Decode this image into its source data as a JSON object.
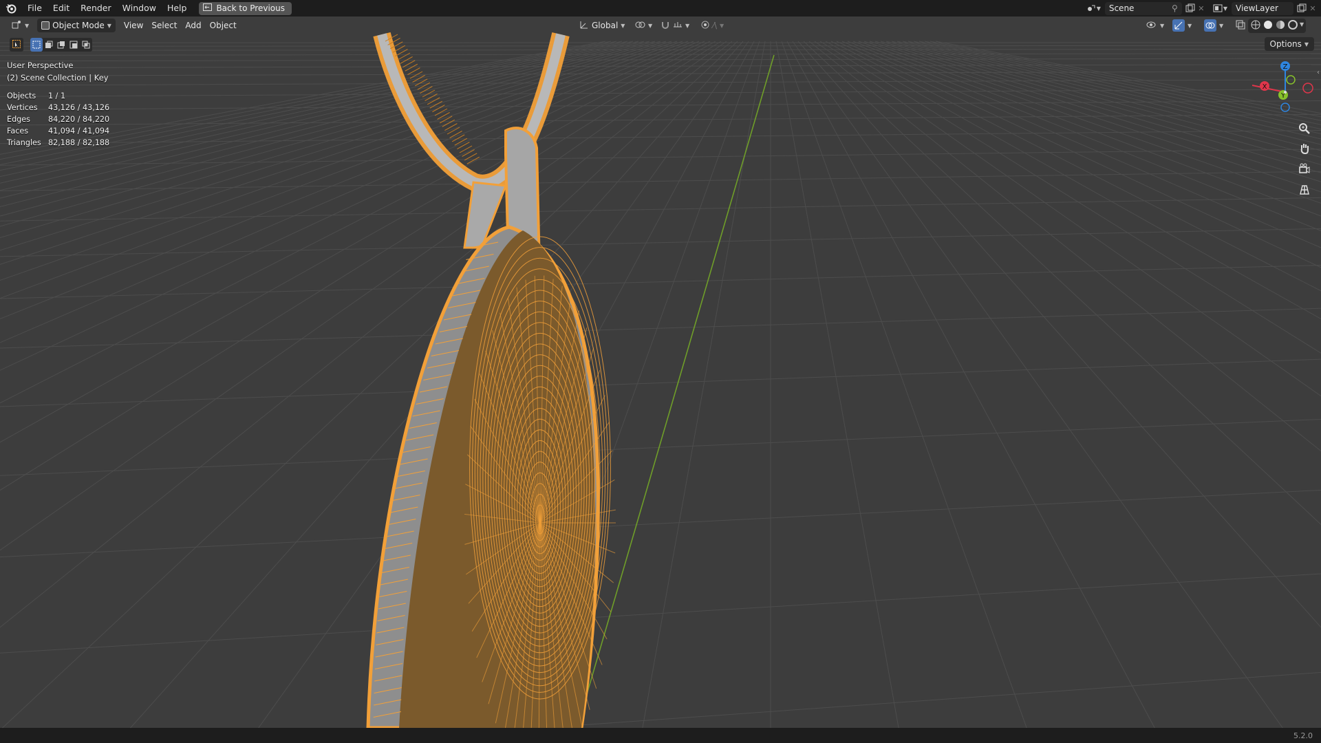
{
  "menu": {
    "items": [
      "File",
      "Edit",
      "Render",
      "Window",
      "Help"
    ],
    "back_button": "Back to Previous"
  },
  "workspace": {
    "scene_name": "Scene",
    "view_layer": "ViewLayer"
  },
  "header": {
    "mode": "Object Mode",
    "menus": [
      "View",
      "Select",
      "Add",
      "Object"
    ],
    "transform_orientation": "Global",
    "options_label": "Options"
  },
  "viewport": {
    "perspective": "User Perspective",
    "collection": "(2) Scene Collection | Key"
  },
  "stats": [
    {
      "label": "Objects",
      "value": "1 / 1"
    },
    {
      "label": "Vertices",
      "value": "43,126 / 43,126"
    },
    {
      "label": "Edges",
      "value": "84,220 / 84,220"
    },
    {
      "label": "Faces",
      "value": "41,094 / 41,094"
    },
    {
      "label": "Triangles",
      "value": "82,188 / 82,188"
    }
  ],
  "gizmo": {
    "x": "X",
    "y": "Y",
    "z": "Z"
  },
  "colors": {
    "selection": "#f2a039",
    "axis_x": "#e0364b",
    "axis_y": "#87c22b",
    "axis_z": "#2f86e0",
    "y_axis_line": "#6f9e29"
  },
  "icons": [
    "blender-logo",
    "back-icon",
    "scene-icon",
    "pin-icon",
    "new-scene-icon",
    "view-layer-icon",
    "select-box-icon",
    "zoom-icon",
    "hand-icon",
    "camera-icon",
    "grid-icon"
  ],
  "version": "5.2.0"
}
